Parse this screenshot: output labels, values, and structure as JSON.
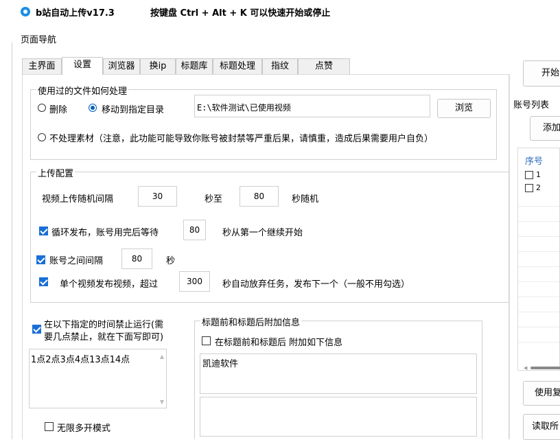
{
  "window": {
    "title": "b站自动上传v17.3",
    "hotkey_hint": "按键盘 Ctrl + Alt + K  可以快速开始或停止"
  },
  "nav_label": "页面导航",
  "tabs": [
    "主界面",
    "设置",
    "浏览器",
    "换ip",
    "标题库",
    "标题处理",
    "指纹",
    "点赞"
  ],
  "active_tab": 1,
  "file_group": {
    "legend": "使用过的文件如何处理",
    "radio_delete": "删除",
    "radio_move": "移动到指定目录",
    "path_value": "E:\\软件测试\\已使用视频",
    "browse_button": "浏览",
    "radio_none": "不处理素材（注意，此功能可能导致你账号被封禁等严重后果，请慎重，造成后果需要用户自负）",
    "selected": "move"
  },
  "upload_group": {
    "legend": "上传配置",
    "interval_label": "视频上传随机间隔",
    "interval_min": "30",
    "interval_to": "秒至",
    "interval_max": "80",
    "interval_suffix": "秒随机",
    "loop_label": "循环发布，账号用完后等待",
    "loop_checked": true,
    "loop_value": "80",
    "loop_suffix": "秒从第一个继续开始",
    "account_interval_label": "账号之间间隔",
    "account_interval_checked": true,
    "account_interval_value": "80",
    "account_interval_suffix": "秒",
    "single_label": "单个视频发布视频，超过",
    "single_checked": true,
    "single_value": "300",
    "single_suffix": "秒自动放弃任务，发布下一个（一般不用勾选）"
  },
  "forbid_time": {
    "label_line1": "在以下指定的时间禁止运行(需",
    "label_line2": "要几点禁止，就在下面写即可)",
    "checked": true,
    "value": "1点2点3点4点13点14点"
  },
  "title_extra": {
    "legend": "标题前和标题后附加信息",
    "checkbox_label": "在标题前和标题后 附加如下信息",
    "checked": false,
    "prefix_value": "凯迪软件",
    "suffix_value": ""
  },
  "unlimited_label": "无限多开模式",
  "unlimited_checked": false,
  "right_panel": {
    "start_button": "开始",
    "account_list_legend": "账号列表",
    "add_button": "添加",
    "col_index": "序号",
    "rows": [
      "1",
      "2"
    ],
    "use_button": "使用复",
    "read_button": "读取所"
  },
  "colors": {
    "accent": "#1a6fd6",
    "table_header": "#2a6bbf"
  }
}
